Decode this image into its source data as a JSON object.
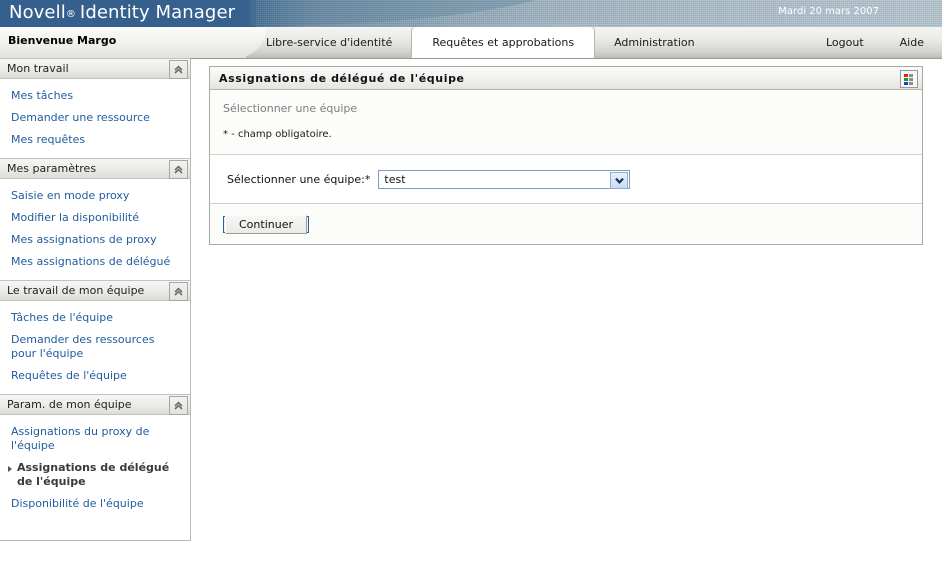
{
  "banner": {
    "brand_name": "Novell",
    "registered_mark": "®",
    "product": "Identity Manager",
    "date": "Mardi 20 mars 2007"
  },
  "nav": {
    "welcome": "Bienvenue  Margo",
    "tabs": [
      {
        "label": "Libre-service d'identité",
        "active": false
      },
      {
        "label": "Requêtes et approbations",
        "active": true
      },
      {
        "label": "Administration",
        "active": false
      }
    ],
    "links": [
      {
        "label": "Logout"
      },
      {
        "label": "Aide"
      }
    ]
  },
  "sidebar": {
    "sections": [
      {
        "title": "Mon travail",
        "toggle_icon": "chevron-up-double-icon",
        "items": [
          {
            "label": "Mes tâches",
            "selected": false
          },
          {
            "label": "Demander une ressource",
            "selected": false
          },
          {
            "label": "Mes requêtes",
            "selected": false
          }
        ]
      },
      {
        "title": "Mes paramètres",
        "toggle_icon": "chevron-up-double-icon",
        "items": [
          {
            "label": "Saisie en mode proxy",
            "selected": false
          },
          {
            "label": "Modifier la disponibilité",
            "selected": false
          },
          {
            "label": "Mes assignations de proxy",
            "selected": false
          },
          {
            "label": "Mes assignations de délégué",
            "selected": false
          }
        ]
      },
      {
        "title": "Le travail de mon équipe",
        "toggle_icon": "chevron-up-double-icon",
        "items": [
          {
            "label": "Tâches de l'équipe",
            "selected": false
          },
          {
            "label": "Demander des ressources pour l'équipe",
            "selected": false
          },
          {
            "label": "Requêtes de l'équipe",
            "selected": false
          }
        ]
      },
      {
        "title": "Param. de mon équipe",
        "toggle_icon": "chevron-up-double-icon",
        "items": [
          {
            "label": "Assignations du proxy de l'équipe",
            "selected": false
          },
          {
            "label": "Assignations de délégué de l'équipe",
            "selected": true
          },
          {
            "label": "Disponibilité de l'équipe",
            "selected": false
          }
        ]
      }
    ]
  },
  "panel": {
    "title": "Assignations de délégué de l'équipe",
    "tool_icon": "color-grid-icon",
    "tool_colors": [
      "#e02020",
      "#8c8c8c",
      "#16a016",
      "#8c8c8c",
      "#1a3fd0",
      "#8c8c8c"
    ],
    "intro": "Sélectionner une équipe",
    "required_note": "* - champ obligatoire.",
    "form": {
      "field_label": "Sélectionner une équipe:*",
      "select_name": "team-select",
      "select_value": "test",
      "select_arrow_icon": "chevron-down-icon"
    },
    "actions": {
      "continue_label": "Continuer"
    }
  },
  "colors": {
    "brand_blue": "#355f8c",
    "link_blue": "#1f5c9e",
    "accent_border": "#2b5fa8"
  }
}
